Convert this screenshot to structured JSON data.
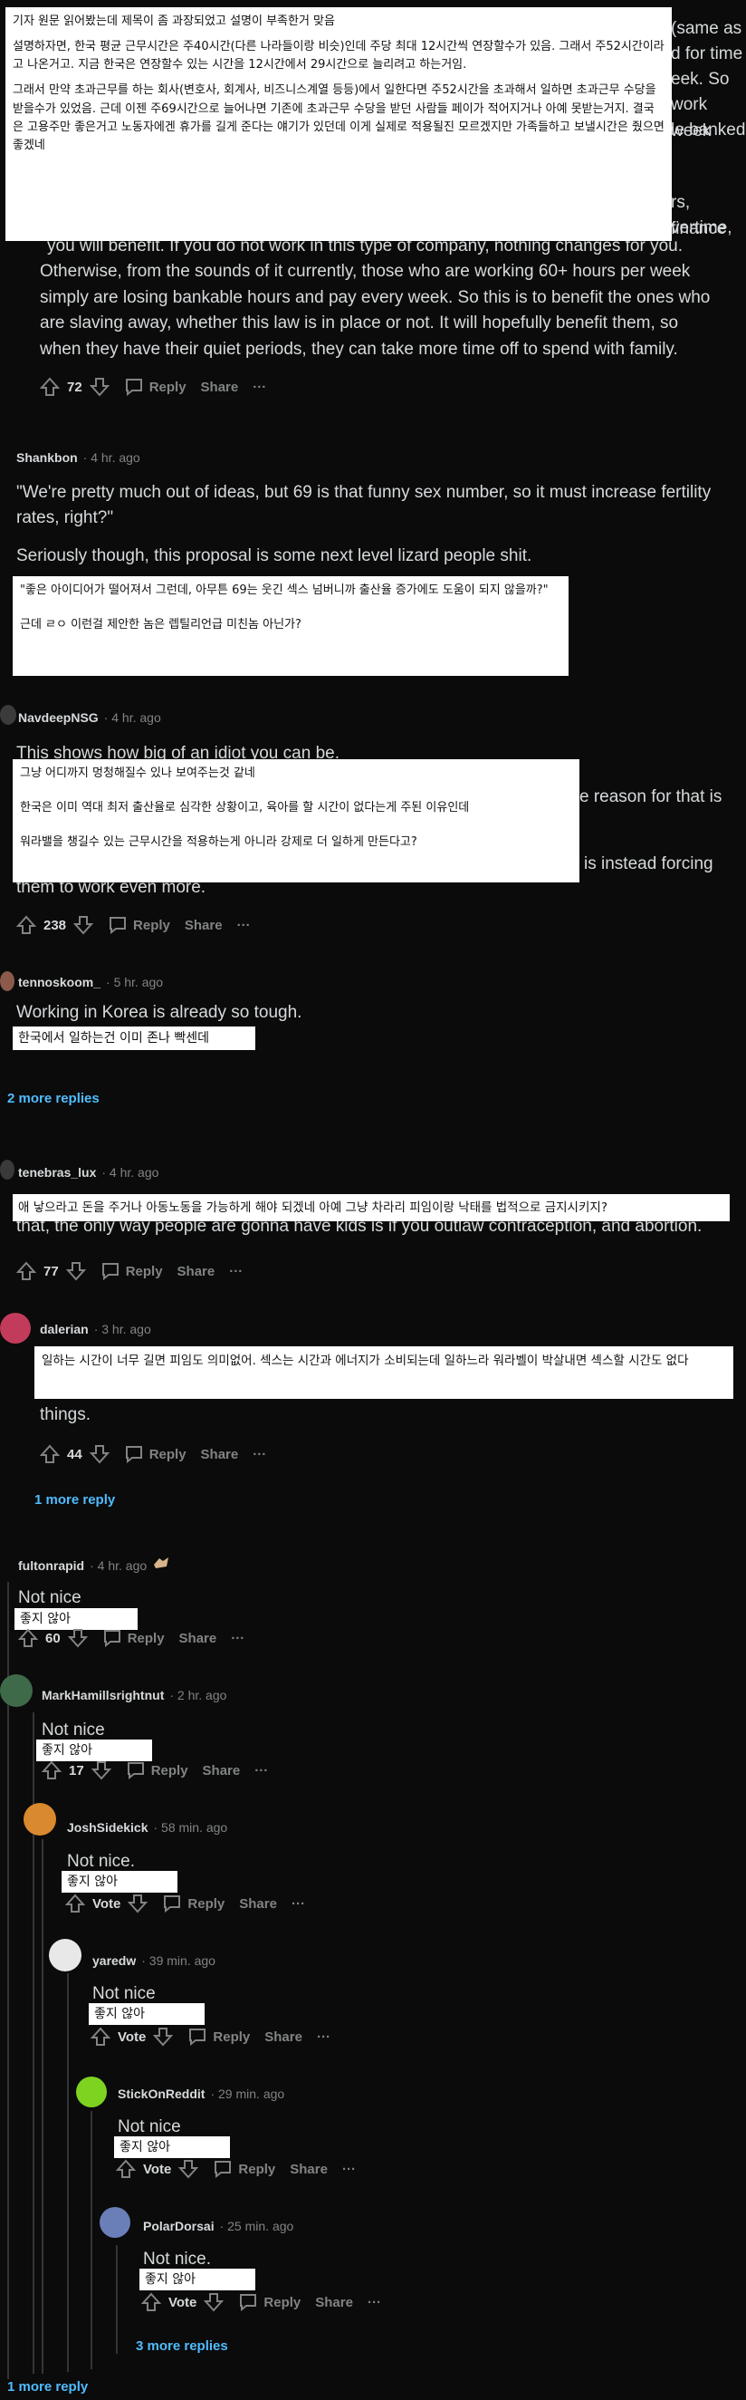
{
  "top_comment": {
    "overlay_paragraphs": [
      "기자 원문 읽어봤는데 제목이 좀 과장되었고 설명이 부족한거 맞음",
      "설명하자면, 한국 평균 근무시간은 주40시간(다른 나라들이랑 비슷)인데 주당 최대 12시간씩 연장할수가 있음. 그래서 주52시간이라고 나온거고. 지금 한국은 연장할수 있는 시간을 12시간에서 29시간으로 늘리려고 하는거임.",
      "그래서 만약 초과근무를 하는 회사(변호사, 회계사, 비즈니스계열 등등)에서 일한다면 주52시간을 초과해서 일하면 초과근무 수당을 받을수가 있었음. 근데 이젠 주69시간으로 늘어나면 기존에 초과근무 수당을 받던 사람들 페이가 적어지거나 아예 못받는거지. 결국은 고용주만 좋은거고 노동자에겐 휴가를 길게 준다는 얘기가 있던데 이게 실제로 적용될진 모르겠지만 가족들하고 보낼시간은 줬으면 좋겠네"
    ],
    "right_fragments": [
      "(same as",
      "d for time",
      "eek. So",
      "work week",
      "le banked",
      "rs, finance",
      "vertime,"
    ],
    "behind_line": "you will benefit. If you do not work in this type of company, nothing changes for you.",
    "english_lines": [
      "Otherwise, from the sounds of it currently, those who are working 60+ hours per week",
      "simply are losing bankable hours and pay every week. So this is to benefit the ones who",
      "are slaving away, whether this law is in place or not. It will hopefully benefit them, so",
      "when they have their quiet periods, they can take more time off to spend with family."
    ],
    "votes": "72"
  },
  "labels": {
    "reply": "Reply",
    "share": "Share",
    "more": "···",
    "vote": "Vote"
  },
  "comments": {
    "shankbon": {
      "username": "Shankbon",
      "time": "· 4 hr. ago",
      "line1": "\"We're pretty much out of ideas, but 69 is that funny sex number, so it must increase fertility",
      "line2": "rates, right?\"",
      "line3": "Seriously though, this proposal is some next level lizard people shit.",
      "overlay1": "\"좋은 아이디어가 떨어져서 그런데, 아무튼 69는 웃긴 섹스 넘버니까 출산율 증가에도 도움이 되지 않을까?\"",
      "overlay2": "근데 ㄹㅇ 이런걸 제안한 놈은 렙틸리언급 미친놈 아닌가?"
    },
    "navdeep": {
      "username": "NavdeepNSG",
      "time": "· 4 hr. ago",
      "line1": "This shows how big of an idiot you can be.",
      "frag1": "e reason for that is",
      "frag2": "is instead forcing",
      "line_last": "them to work even more.",
      "overlay1": "그냥 어디까지 멍청해질수 있나 보여주는것 같네",
      "overlay2": "한국은 이미 역대 최저 출산율로 심각한 상황이고, 육아를 할 시간이 없다는게 주된 이유인데",
      "overlay3": "워라밸을 챙길수 있는 근무시간을 적용하는게 아니라 강제로 더 일하게 만든다고?",
      "votes": "238"
    },
    "tenno": {
      "username": "tennoskoom_",
      "time": "· 5 hr. ago",
      "line1": "Working in Korea is already so tough.",
      "overlay1": "한국에서 일하는건 이미 존나 빡센데",
      "more": "2 more replies"
    },
    "tenebras": {
      "username": "tenebras_lux",
      "time": "· 4 hr. ago",
      "line1": "that, the only way people are gonna have kids is if you outlaw contraception, and abortion.",
      "overlay1": "애 낳으라고 돈을 주거나 아동노동을 가능하게 해야 되겠네 아예 그냥 차라리 피임이랑 낙태를 법적으로 금지시키지?",
      "votes": "77"
    },
    "dalerian": {
      "username": "dalerian",
      "time": "· 3 hr. ago",
      "line_last": "things.",
      "overlay1": "일하는 시간이 너무 길면 피임도 의미없어. 섹스는 시간과 에너지가 소비되는데 일하느라 워라벨이 박살내면 섹스할 시간도 없다",
      "votes": "44",
      "more": "1 more reply"
    },
    "fulton": {
      "username": "fultonrapid",
      "time": "· 4 hr. ago",
      "line1": "Not nice",
      "overlay1": "좋지 않아",
      "votes": "60"
    },
    "mark": {
      "username": "MarkHamillsrightnut",
      "time": "· 2 hr. ago",
      "line1": "Not nice",
      "overlay1": "좋지 않아",
      "votes": "17"
    },
    "josh": {
      "username": "JoshSidekick",
      "time": "· 58 min. ago",
      "line1": "Not nice.",
      "overlay1": "좋지 않아"
    },
    "yared": {
      "username": "yaredw",
      "time": "· 39 min. ago",
      "line1": "Not nice",
      "overlay1": "좋지 않아"
    },
    "stick": {
      "username": "StickOnReddit",
      "time": "· 29 min. ago",
      "line1": "Not nice",
      "overlay1": "좋지 않아"
    },
    "polar": {
      "username": "PolarDorsai",
      "time": "· 25 min. ago",
      "line1": "Not nice.",
      "overlay1": "좋지 않아",
      "more": "3 more replies"
    }
  },
  "bottom_more": "1 more reply",
  "colors": {
    "background": "#0b0b0b",
    "link": "#4fbcff",
    "muted": "#818384",
    "text": "#d7dadc"
  }
}
